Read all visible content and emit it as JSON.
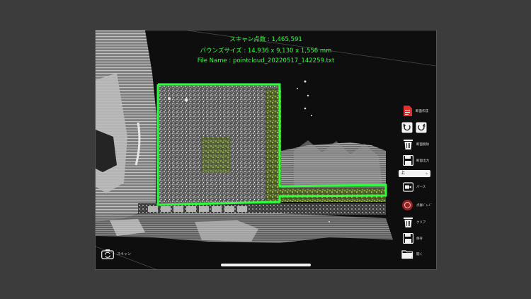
{
  "overlay": {
    "scan_points": "スキャン点数 : 1,465,591",
    "bounds_size": "バウンズサイズ : 14,936 x 9,130 x 1,556 mm",
    "file_name": "File Name : pointcloud_20220517_142259.txt"
  },
  "toolbar": {
    "create_section": "断面作成",
    "delete_section": "断面削除",
    "output_section": "断面出力",
    "view_select": "上",
    "perspective": "パース",
    "point_cloud_mode": "点群ｼﾞｮｰﾄﾞ",
    "clear": "クリア",
    "save": "保存",
    "open": "開く"
  },
  "scan_button": {
    "label": "スキャン"
  },
  "colors": {
    "accent_green": "#2cff3a",
    "icon_red": "#e0302e",
    "background": "#3c3c3c"
  }
}
